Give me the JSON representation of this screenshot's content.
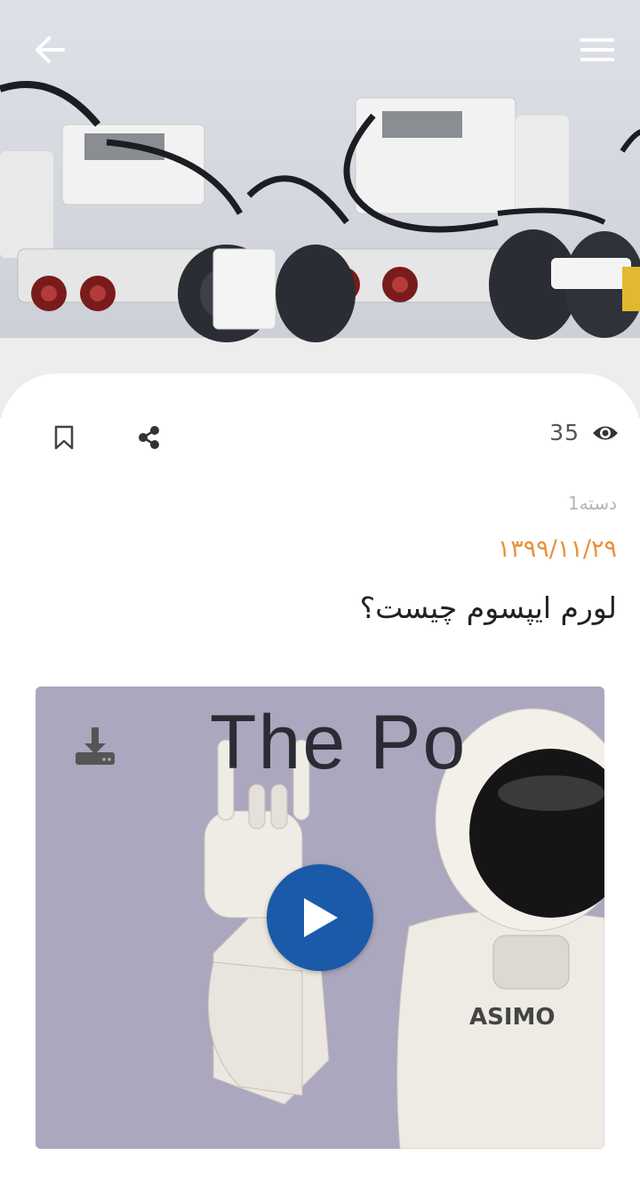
{
  "header": {
    "back_icon": "arrow-left-icon",
    "menu_icon": "hamburger-menu-icon",
    "hero_image": "lego-robots-photo"
  },
  "actions": {
    "bookmark_icon": "bookmark-icon",
    "share_icon": "share-icon",
    "views_icon": "eye-icon",
    "views_count": "35"
  },
  "article": {
    "category": "دسته1",
    "date": "۱۳۹۹/۱۱/۲۹",
    "title": "لورم ایپسوم چیست؟"
  },
  "video": {
    "poster_text": "The Po",
    "download_icon": "download-icon",
    "play_icon": "play-icon"
  },
  "colors": {
    "accent": "#e8913a",
    "play_button": "#1a5aa8",
    "title_text": "#222222",
    "muted_text": "#b5b5b5"
  }
}
